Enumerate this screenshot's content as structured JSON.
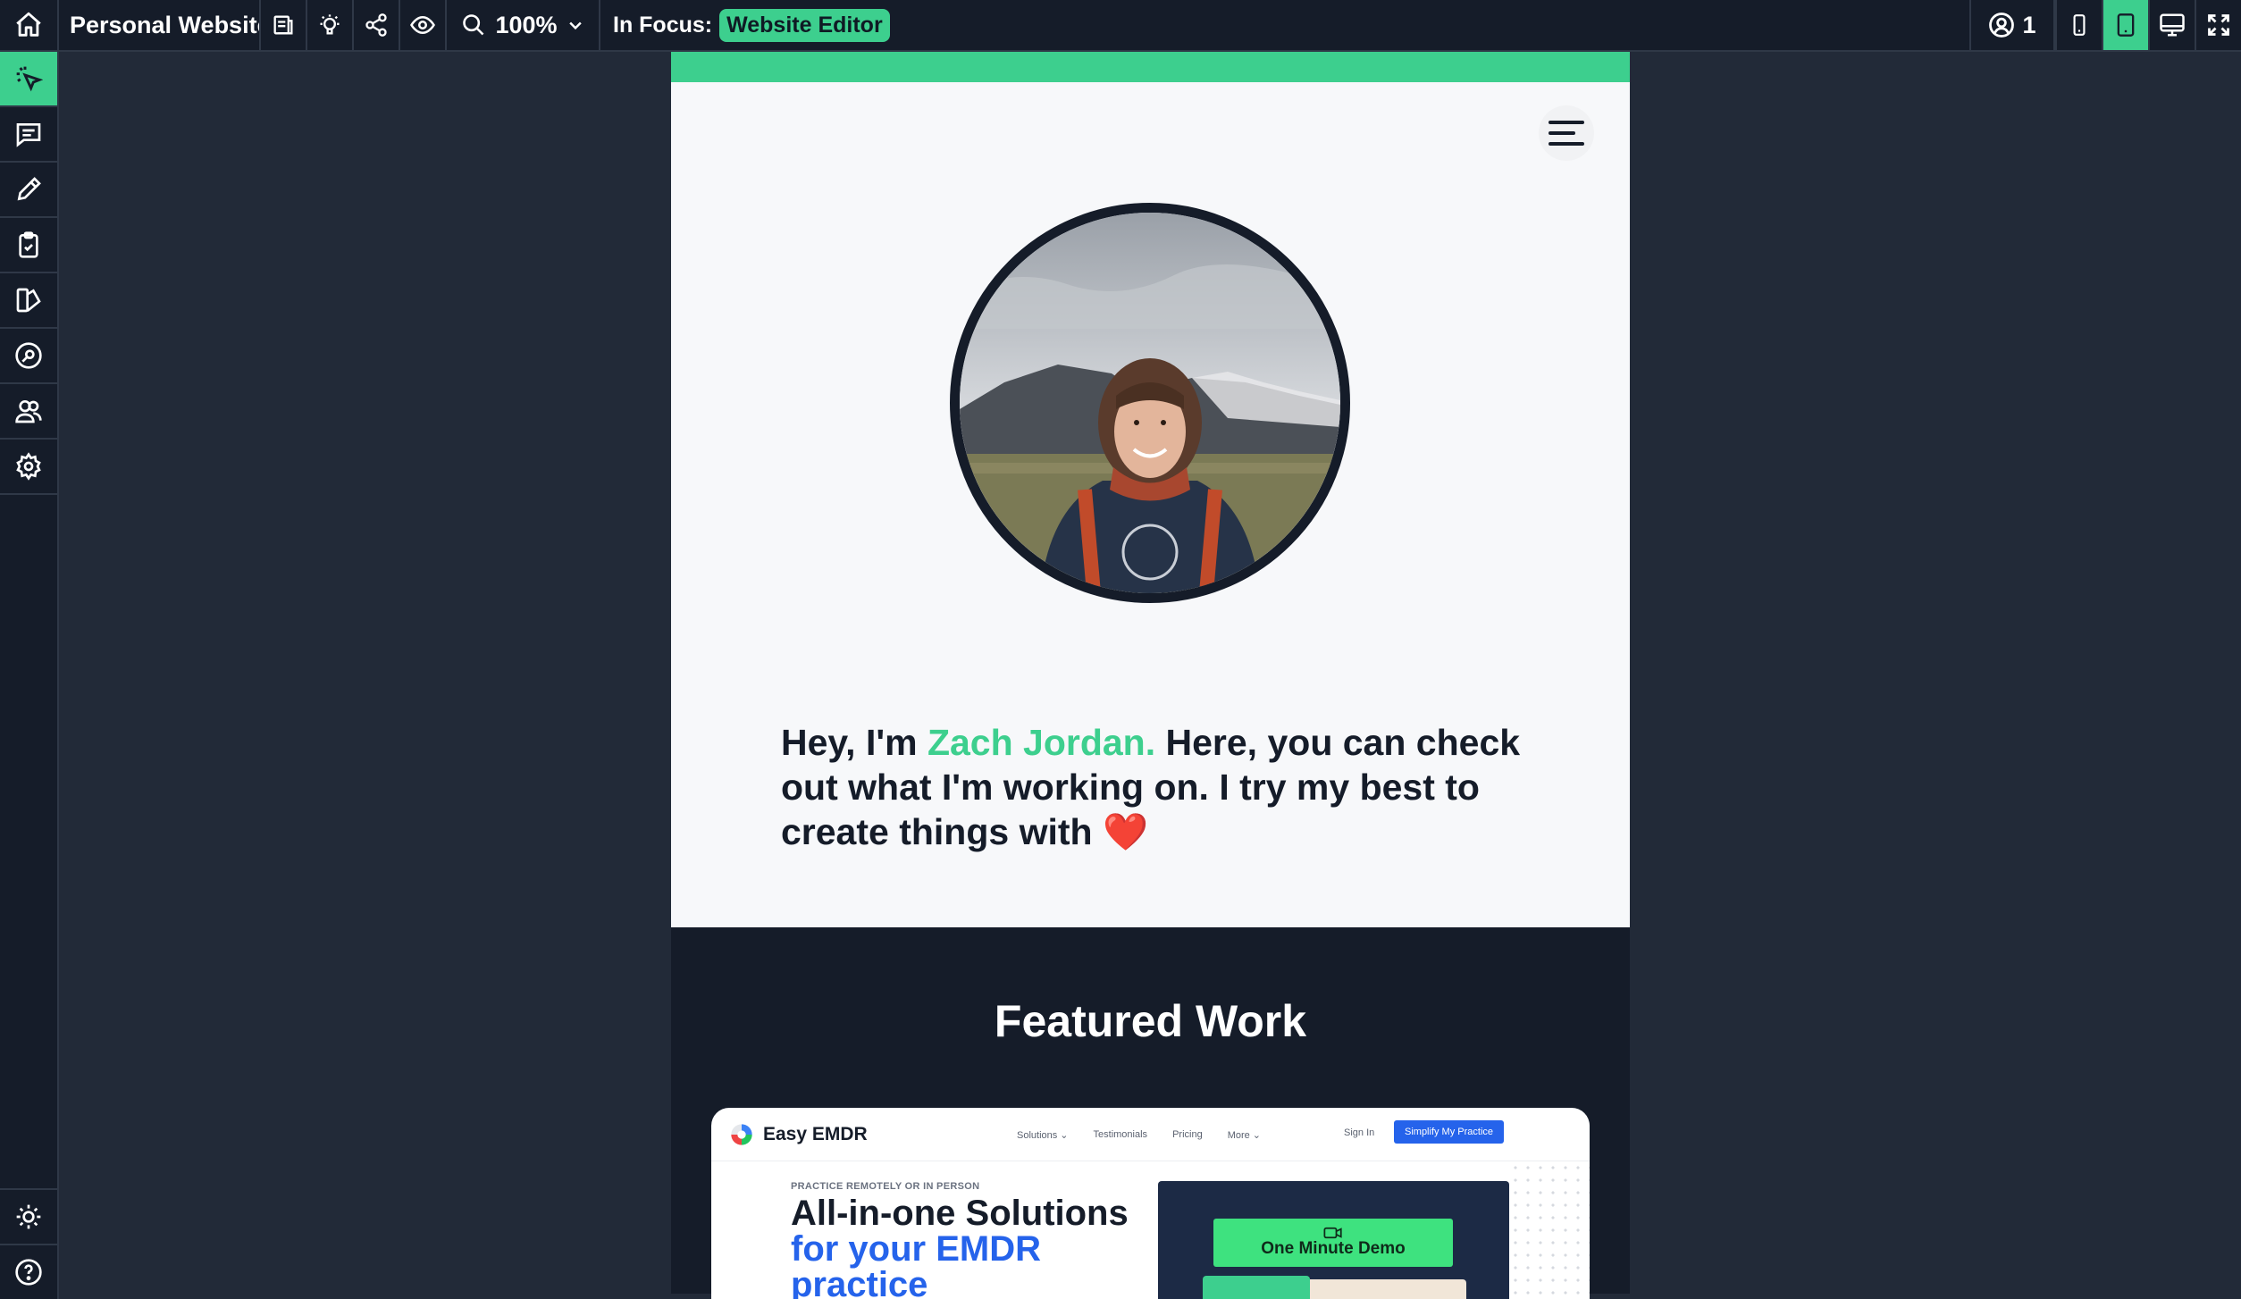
{
  "app": {
    "title": "Personal Website",
    "zoom": "100%",
    "focus_label": "In Focus:",
    "focus_value": "Website Editor",
    "user_count": "1",
    "colors": {
      "accent": "#3dcf8e",
      "bar": "#151c29",
      "canvas": "#222a38"
    }
  },
  "toolbar": {
    "icons": [
      "home-icon",
      "page-icon",
      "lightbulb-icon",
      "share-icon",
      "eye-icon",
      "search-icon",
      "chevron-down-icon"
    ],
    "devices": [
      "phone-icon",
      "tablet-icon",
      "desktop-icon",
      "fullscreen-icon"
    ],
    "active_device": "tablet"
  },
  "sidebar": {
    "items": [
      "cursor-select-icon",
      "comment-icon",
      "edit-pencil-icon",
      "clipboard-check-icon",
      "design-icon",
      "search-circle-icon",
      "team-icon",
      "settings-icon"
    ],
    "bottom": [
      "brightness-icon",
      "help-icon"
    ],
    "active": "cursor-select-icon"
  },
  "site": {
    "intro_prefix": "Hey, I'm ",
    "intro_name": "Zach Jordan.",
    "intro_suffix": " Here, you can check out what I'm working on. I try my best to create things with ",
    "heart": "❤️",
    "featured_title": "Featured Work",
    "card": {
      "brand": "Easy EMDR",
      "nav": [
        "Solutions ⌄",
        "Testimonials",
        "Pricing",
        "More ⌄"
      ],
      "signin": "Sign In",
      "cta": "Simplify My Practice",
      "kicker": "PRACTICE REMOTELY OR IN PERSON",
      "headline_1": "All-in-one Solutions",
      "headline_2": "for your EMDR",
      "headline_3": "practice",
      "demo": "One Minute Demo"
    }
  }
}
